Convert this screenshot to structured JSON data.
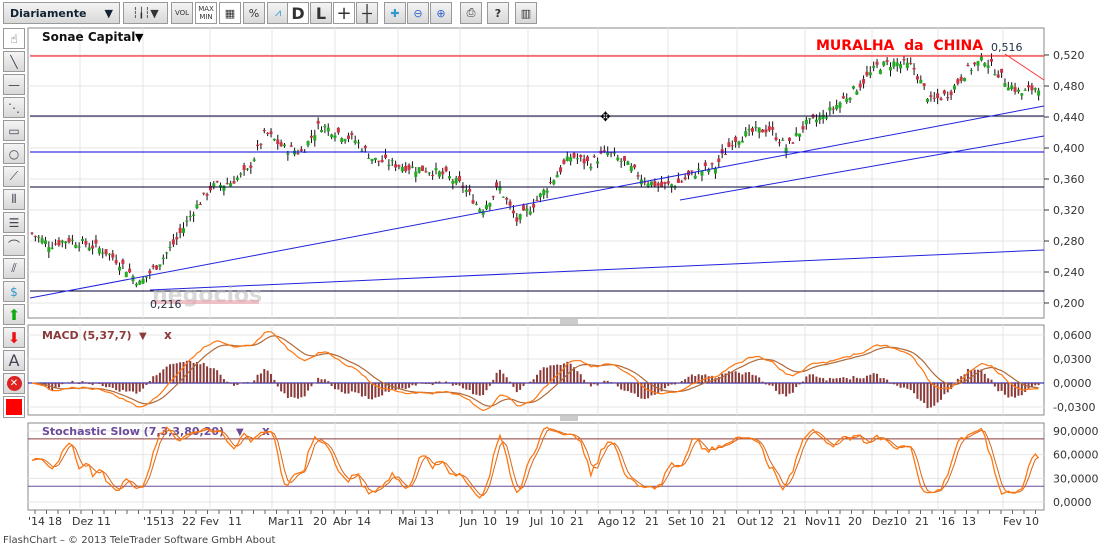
{
  "toolbar": {
    "period": "Diariamente",
    "vol": "VOL",
    "maxmin_top": "MAX",
    "maxmin_bottom": "MIN",
    "percent": "%",
    "d": "D",
    "l": "L",
    "help": "?"
  },
  "chart": {
    "instrument": "Sonae Capital",
    "annotation": "MURALHA  da  CHINA",
    "high_label": "0,516",
    "low_label": "0,216",
    "watermark": "negocios",
    "price_axis": [
      "0,520",
      "0,480",
      "0,440",
      "0,400",
      "0,360",
      "0,320",
      "0,280",
      "0,240",
      "0,200"
    ],
    "macd_label": "MACD (5,37,7)",
    "macd_axis": [
      "0,0600",
      "0,0300",
      "0,0000",
      "-0,0300"
    ],
    "stoch_label": "Stochastic Slow (7,3,3,80,20)",
    "stoch_axis": [
      "90,0000",
      "60,0000",
      "30,0000",
      "0,0000"
    ],
    "close_x": "x",
    "date_labels": [
      "'14",
      "18",
      "Dez",
      "11",
      "'15",
      "13",
      "22",
      "Fev",
      "11",
      "Mar",
      "11",
      "20",
      "Abr",
      "14",
      "Mai",
      "13",
      "Jun",
      "10",
      "19",
      "Jul",
      "10",
      "21",
      "Ago",
      "12",
      "21",
      "Set",
      "10",
      "21",
      "Out",
      "12",
      "21",
      "Nov",
      "11",
      "20",
      "Dez",
      "10",
      "21",
      "'16",
      "13",
      "Fev",
      "10"
    ],
    "approx_closes": [
      0.29,
      0.275,
      0.282,
      0.276,
      0.268,
      0.25,
      0.225,
      0.25,
      0.28,
      0.32,
      0.35,
      0.355,
      0.37,
      0.42,
      0.4,
      0.395,
      0.43,
      0.42,
      0.41,
      0.385,
      0.38,
      0.375,
      0.372,
      0.365,
      0.35,
      0.32,
      0.35,
      0.305,
      0.33,
      0.36,
      0.39,
      0.38,
      0.395,
      0.38,
      0.36,
      0.35,
      0.355,
      0.37,
      0.375,
      0.41,
      0.42,
      0.425,
      0.4,
      0.43,
      0.44,
      0.46,
      0.48,
      0.505,
      0.51,
      0.505,
      0.46,
      0.47,
      0.5,
      0.515,
      0.49,
      0.47,
      0.48
    ],
    "colors": {
      "up": "#22aa22",
      "down": "#cc3344",
      "resistance": "#ff0000",
      "support": "#0000dd",
      "macd": "#ff7711",
      "signal": "#b06a3a",
      "hist": "#8b3a3a",
      "stoch": "#ff7711"
    }
  },
  "footer": "FlashChart – © 2013 TeleTrader Software GmbH About"
}
